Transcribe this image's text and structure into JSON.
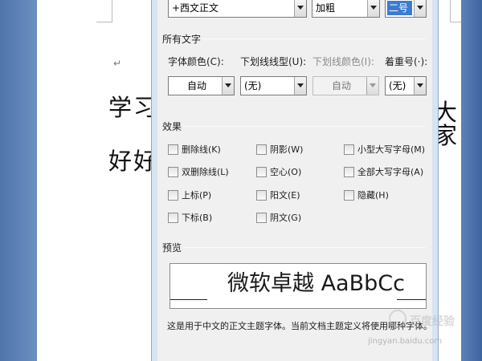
{
  "document": {
    "paragraph_mark": "↵",
    "line1": "学习",
    "line2": "好好",
    "line1_tail": "大家"
  },
  "dialog": {
    "top_row": {
      "font": "+西文正文",
      "style": "加粗",
      "size": "二号"
    },
    "all_text": {
      "title": "所有文字",
      "font_color_label": "字体颜色(C):",
      "font_color_value": "自动",
      "underline_type_label": "下划线线型(U):",
      "underline_type_value": "(无)",
      "underline_color_label": "下划线颜色(I):",
      "underline_color_value": "自动",
      "emphasis_label": "着重号(·):",
      "emphasis_value": "(无)"
    },
    "effects": {
      "title": "效果",
      "items": [
        "删除线(K)",
        "双删除线(L)",
        "上标(P)",
        "下标(B)",
        "阴影(W)",
        "空心(O)",
        "阳文(E)",
        "阴文(G)",
        "小型大写字母(M)",
        "全部大写字母(A)",
        "隐藏(H)"
      ]
    },
    "preview": {
      "title": "预览",
      "sample": "微软卓越 AaBbCc",
      "description": "这是用于中文的正文主题字体。当前文档主题定义将使用哪种字体。"
    }
  },
  "watermark": {
    "text": "百度经验",
    "url": "jingyan.baidu.com"
  },
  "colors": {
    "dialog_frame": "#d7e4f2",
    "dialog_body": "#f0f0f0",
    "selection": "#3d7bd1",
    "doc_side": "#5a7fb8"
  }
}
